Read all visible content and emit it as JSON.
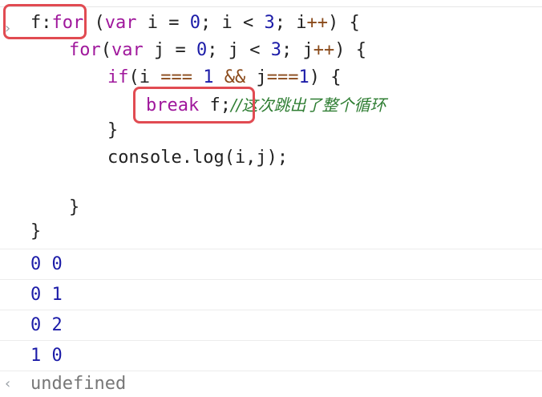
{
  "input": {
    "prompt_icon": "chevron-right-icon",
    "lines": [
      {
        "label": "f",
        "colon": ":",
        "kw1": "for",
        "rest1": " (",
        "kw2": "var",
        "rest2": " i = ",
        "n1": "0",
        "rest3": "; i < ",
        "n2": "3",
        "rest4": "; i",
        "op1": "++",
        "rest5": ") {"
      },
      {
        "kw1": "for",
        "rest1": "(",
        "kw2": "var",
        "rest2": " j = ",
        "n1": "0",
        "rest3": "; j < ",
        "n2": "3",
        "rest4": "; j",
        "op1": "++",
        "rest5": ") {"
      },
      {
        "kw1": "if",
        "rest1": "(i ",
        "op1": "===",
        "rest2": " ",
        "n1": "1",
        "rest3": " ",
        "op2": "&&",
        "rest4": " j",
        "op3": "===",
        "n2": "1",
        "rest5": ") {"
      },
      {
        "kw1": "break",
        "rest1": " f;",
        "comment": "//这次跳出了整个循环"
      },
      {
        "text": "}"
      },
      {
        "text": "console.log(i,j);"
      },
      {
        "text": "}"
      },
      {
        "text": "}"
      }
    ]
  },
  "output": {
    "rows": [
      "0 0",
      "0 1",
      "0 2",
      "1 0"
    ]
  },
  "result": {
    "icon": "chevron-left-icon",
    "text": "undefined"
  },
  "colors": {
    "highlight": "#e14b52",
    "keyword": "#a0189c",
    "number": "#1c1ca8",
    "comment": "#2e7d32"
  }
}
